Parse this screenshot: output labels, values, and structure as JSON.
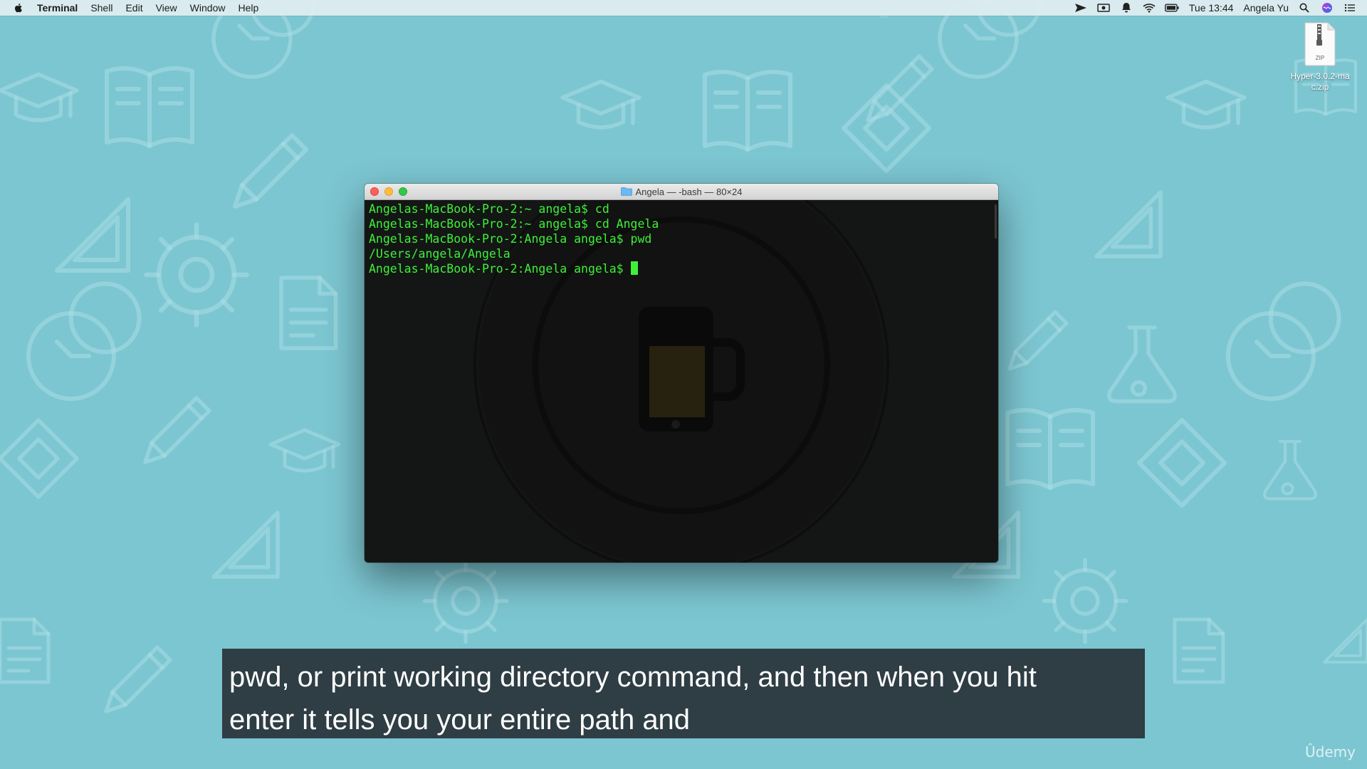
{
  "menubar": {
    "apple_icon": "apple-logo-icon",
    "items": [
      "Terminal",
      "Shell",
      "Edit",
      "View",
      "Window",
      "Help"
    ],
    "status_icons": [
      "send-icon",
      "screen-record-icon",
      "notification-icon",
      "wifi-icon",
      "battery-icon"
    ],
    "clock": "Tue 13:44",
    "user": "Angela Yu",
    "right_icons": [
      "spotlight-icon",
      "siri-icon",
      "notification-center-icon"
    ]
  },
  "desktop": {
    "file_icon": "zip-file-icon",
    "file_badge": "ZIP",
    "file_label": "Hyper-3.0.2-mac.zip"
  },
  "terminal": {
    "title": "Angela — -bash — 80×24",
    "lines": [
      "Angelas-MacBook-Pro-2:~ angela$ cd",
      "Angelas-MacBook-Pro-2:~ angela$ cd Angela",
      "Angelas-MacBook-Pro-2:Angela angela$ pwd",
      "/Users/angela/Angela"
    ],
    "prompt": "Angelas-MacBook-Pro-2:Angela angela$ ",
    "text_color": "#3ef03a",
    "background_color": "#141615"
  },
  "subtitle": {
    "line1": "pwd, or print working directory command, and then when you hit",
    "line2": "enter it tells you your entire path and"
  },
  "watermark_text": "Ûdemy",
  "colors": {
    "desktop_background": "#7cc6d1",
    "subtitle_background": "#2a343a"
  }
}
